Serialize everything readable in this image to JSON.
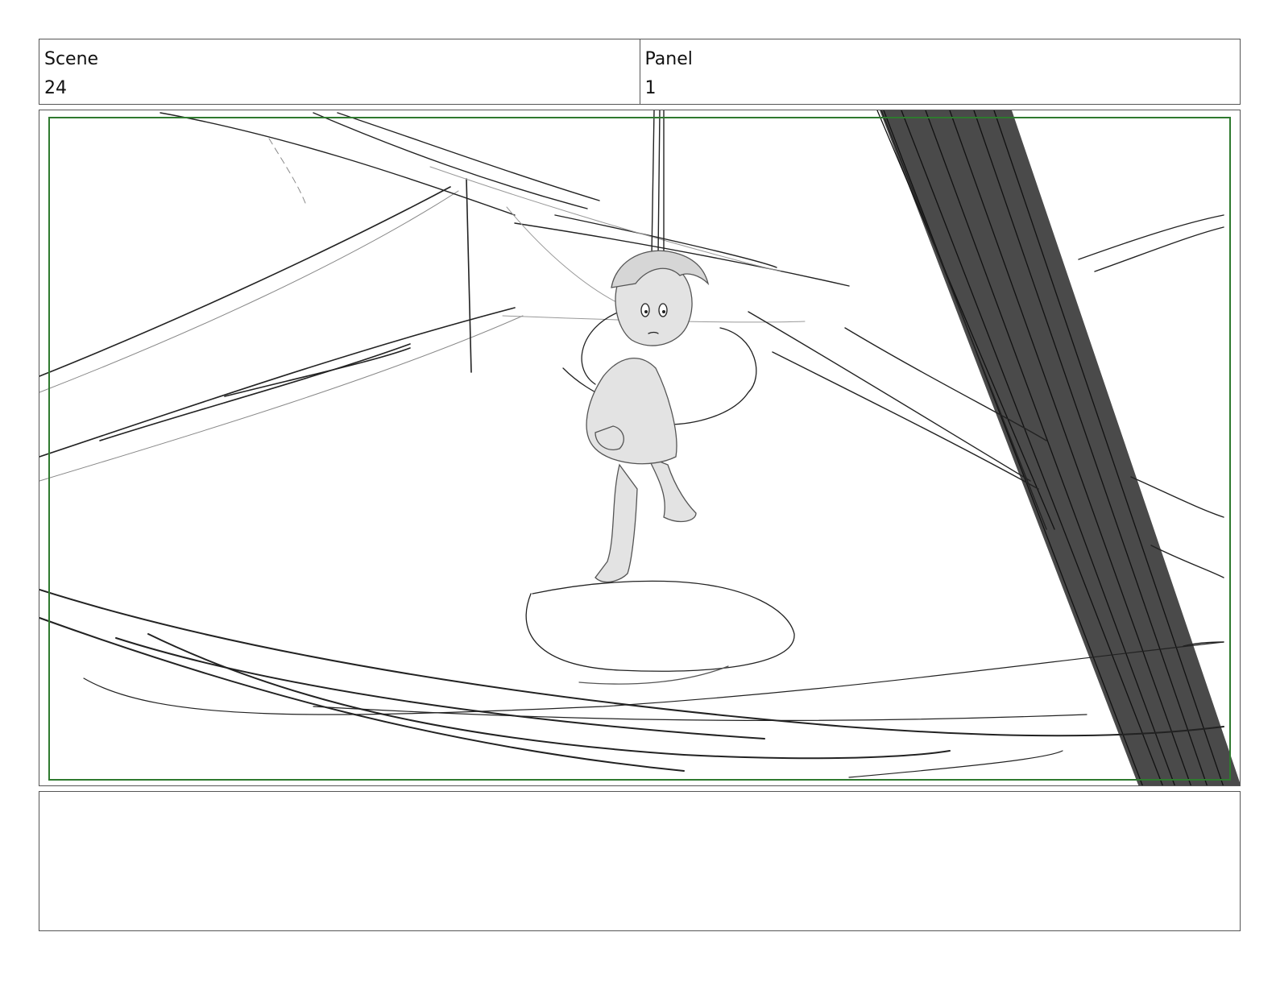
{
  "header": {
    "scene_label": "Scene",
    "scene_value": "24",
    "panel_label": "Panel",
    "panel_value": "1"
  },
  "notes": {
    "text": ""
  },
  "colors": {
    "safe_frame": "#2f7a2f",
    "pillar": "#4a4a4a",
    "character_fill": "#e3e3e3"
  }
}
